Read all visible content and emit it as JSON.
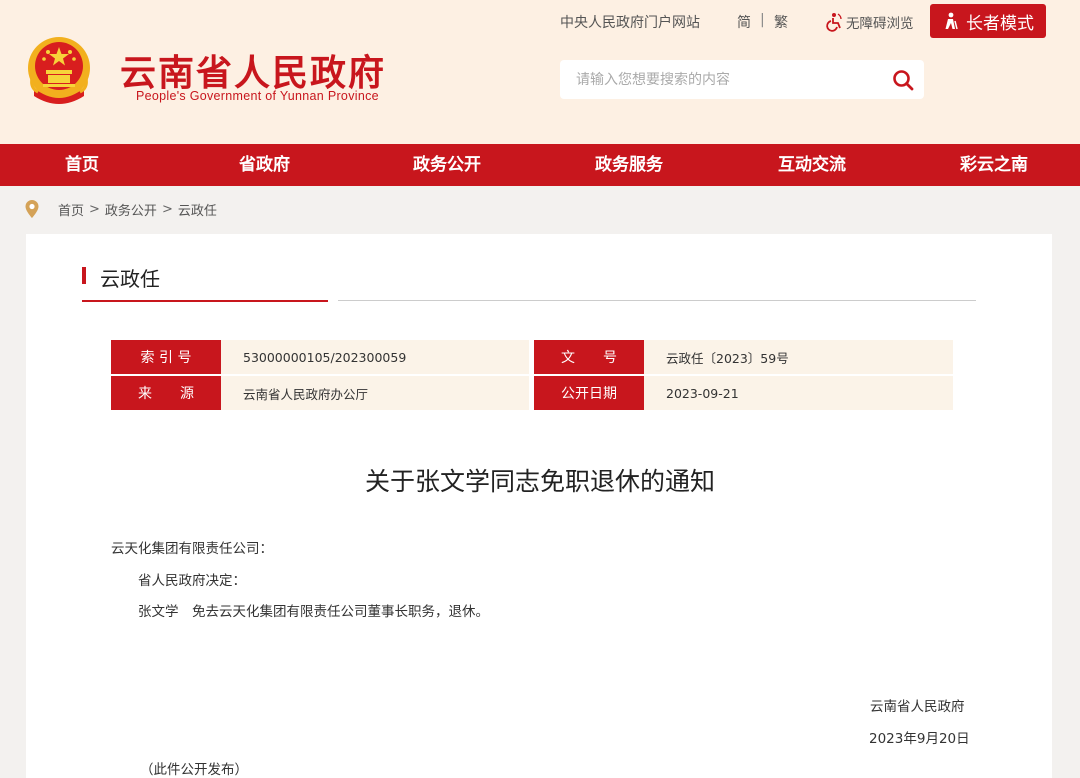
{
  "header": {
    "site_name": "云南省人民政府",
    "site_sub": "People's Government of Yunnan Province",
    "portal_link": "中央人民政府门户网站",
    "lang_simple": "简",
    "lang_sep": "|",
    "lang_trad": "繁",
    "accessibility": "无障碍浏览",
    "elder_mode": "长者模式",
    "search_placeholder": "请输入您想要搜索的内容"
  },
  "nav": {
    "items": [
      "首页",
      "省政府",
      "政务公开",
      "政务服务",
      "互动交流",
      "彩云之南"
    ]
  },
  "breadcrumb": [
    "首页",
    "政务公开",
    "云政任"
  ],
  "breadcrumb_sep": ">",
  "section": {
    "title": "云政任"
  },
  "meta": {
    "index_label": "索 引 号",
    "index_value": "53000000105/202300059",
    "docno_label": "文　　号",
    "docno_value": "云政任〔2023〕59号",
    "source_label": "来　　源",
    "source_value": "云南省人民政府办公厅",
    "date_label": "公开日期",
    "date_value": "2023-09-21"
  },
  "document": {
    "title": "关于张文学同志免职退休的通知",
    "recipient": "云天化集团有限责任公司：",
    "line1": "省人民政府决定：",
    "line2": "张文学　免去云天化集团有限责任公司董事长职务，退休。",
    "signer": "云南省人民政府",
    "sign_date": "2023年9月20日",
    "note": "（此件公开发布）"
  },
  "colors": {
    "brand_red": "#c8161d",
    "header_bg": "#fdf0e3",
    "meta_bg": "#fbf3e8"
  }
}
